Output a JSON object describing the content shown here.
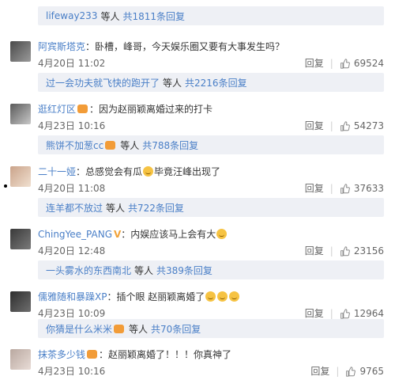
{
  "top_reply": {
    "who": "lifeway233",
    "mid": "等人",
    "total": "共1811条回复"
  },
  "comments": [
    {
      "name": "阿宾斯塔克",
      "text": "：卧槽，峰哥，今天娱乐圈又要有大事发生吗？",
      "date": "4月20日 11:02",
      "reply_label": "回复",
      "likes": "69524",
      "avatar_colors": [
        "#4a4a4a",
        "#9a9a9a"
      ],
      "sub": {
        "who": "过一会功夫就飞快的跑开了",
        "mid": "等人",
        "total": "共2216条回复"
      }
    },
    {
      "name": "逛红灯区",
      "badge": true,
      "text": "：因为赵丽颖离婚过来的打卡",
      "date": "4月23日 10:16",
      "reply_label": "回复",
      "likes": "54273",
      "avatar_colors": [
        "#5a5a5a",
        "#c8c8c8"
      ],
      "sub": {
        "who": "熊饼不加葱cc",
        "badge": true,
        "mid": "等人",
        "total": "共788条回复"
      }
    },
    {
      "name": "二十一娅",
      "text": "：总感觉会有瓜",
      "emoji_after_text": 1,
      "text2": "毕竟汪峰出现了",
      "date": "4月20日 11:08",
      "reply_label": "回复",
      "likes": "37633",
      "avatar_colors": [
        "#caa38a",
        "#f0e0d0"
      ],
      "sub": {
        "who": "连羊都不放过",
        "mid": "等人",
        "total": "共722条回复"
      }
    },
    {
      "name": "ChingYee_PANG",
      "vbadge": true,
      "text": "：内娱应该马上会有大",
      "emoji_after_text": 1,
      "date": "4月20日 12:48",
      "reply_label": "回复",
      "likes": "23156",
      "avatar_colors": [
        "#3a3a3a",
        "#7a7a7a"
      ],
      "sub": {
        "who": "一头雾水的东西南北",
        "mid": "等人",
        "total": "共389条回复"
      }
    },
    {
      "name": "儒雅随和暴躁XP",
      "text": "：插个眼 赵丽颖离婚了",
      "emoji_after_text": 3,
      "date": "4月23日 10:09",
      "reply_label": "回复",
      "likes": "12964",
      "avatar_colors": [
        "#2e2e2e",
        "#6e6e6e"
      ],
      "sub": {
        "who": "你猜是什么米米",
        "badge": true,
        "mid": "等人",
        "total": "共70条回复"
      }
    },
    {
      "name": "抹茶多少钱",
      "badge": true,
      "text": "：赵丽颖离婚了！！！你真神了",
      "date": "4月23日 10:16",
      "reply_label": "回复",
      "likes": "9765",
      "avatar_colors": [
        "#b9a8a0",
        "#e8dcd6"
      ]
    }
  ],
  "colors": {
    "link": "#4a7fc7",
    "reply_bg": "#eef0f5"
  },
  "icons": {
    "thumb": "thumbs-up-icon",
    "avatar": "user-avatar"
  }
}
